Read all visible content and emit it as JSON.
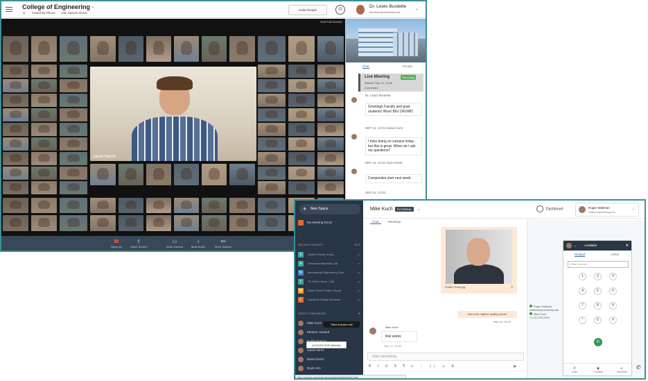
{
  "top": {
    "org_name": "College of Engineering",
    "sub_items": [
      "Joined By Phone",
      "Join Spaces Room"
    ],
    "invite_label": "Invite People",
    "user_name": "Dr. Lewis Burdette",
    "user_email": "lburdette@university.edu",
    "exit_fullscreen": "Exit Full Screen"
  },
  "meeting": {
    "active_speaker": "Jared Harris",
    "toolbar": [
      "Hang Up",
      "Share Screen",
      "Mute Camera",
      "Mute Audio",
      "More Options"
    ]
  },
  "chat_panel": {
    "tabs": [
      "Chat",
      "People"
    ],
    "live_title": "Live Meeting",
    "live_badge": "Recording",
    "live_started": "Started: Sep 14, 13:30",
    "live_sub": "Connected",
    "messages": [
      {
        "meta": "Dr. Lewis Burdette",
        "text": "Greetings Faculty and grad students! Wow! BIG CROWD"
      },
      {
        "meta": "SEP 14, 13:31  Diana Gorst",
        "text": "I miss being on campus today - but this is great. When do I ask my questions?"
      },
      {
        "meta": "SEP 14, 13:32  Arjun Khatri",
        "text": "Composites start next week."
      },
      {
        "meta": "SEP 14, 13:33",
        "text": ""
      }
    ]
  },
  "messaging": {
    "new_space": "New Space",
    "my_meeting_room": "My Meeting Room",
    "section_spaces": "RECENT SPACES",
    "spaces": [
      {
        "letter": "S",
        "color": "#3aa8a0",
        "label": "Student Study Group"
      },
      {
        "letter": "A",
        "color": "#3aa8a0",
        "label": "Advanced Materials Lab"
      },
      {
        "letter": "M",
        "color": "#4a82c0",
        "label": "Mechanical Engineering Dept"
      },
      {
        "letter": "T",
        "color": "#3aa8a0",
        "label": "TA Office Hours - Fall"
      },
      {
        "letter": "W",
        "color": "#e8a030",
        "label": "Wind Tunnel Project Group"
      },
      {
        "letter": "C",
        "color": "#e06a3a",
        "label": "Capstone Design Reviews"
      }
    ],
    "section_direct": "DIRECT MESSAGES",
    "direct": [
      "Mike Kuch",
      "Eleanor Howard",
      "Ruthie Ramos",
      "Jared Harris",
      "Diana Gorst",
      "Noah Kim"
    ],
    "tooltip1": "Start a phone call",
    "tooltip2": "(412)225-0199 (Mobile)",
    "status_url": "https://spaces.university.edu/messaging/direct/mike-kuch"
  },
  "conversation": {
    "name": "Mike Kuch",
    "badge": "EXTERNAL",
    "dashboard": "Dashboard",
    "presence_name": "Roger Wallman",
    "presence_email": "rwallman@university.edu",
    "tabs": [
      "Chat",
      "Meetings"
    ],
    "photo_file": "Profile Photo.jpg",
    "photo_caption": "this is the highest quality picture",
    "ts1": "Sep 14, 13:42",
    "sender": "Mike Kuch",
    "message": "that works",
    "ts2": "Sep 14, 13:44",
    "compose_placeholder": "Start something",
    "format_tools": "B I U S ¶ ≡ ⋮ ⟨⟩ ☺ A",
    "call_log": [
      "Roger Wallman",
      "rwallman@university.edu",
      "Mike Kuch",
      "+1 412 225 0199"
    ]
  },
  "dialer": {
    "status": "Available",
    "tabs": [
      "Dialpad",
      "Active"
    ],
    "input_placeholder": "Enter number",
    "keys": [
      "1",
      "2",
      "3",
      "4",
      "5",
      "6",
      "7",
      "8",
      "9",
      "*",
      "0",
      "#"
    ],
    "bottom": [
      "Calls",
      "Contacts",
      "Voicemail"
    ]
  },
  "colors": {
    "accent": "#3c8f95",
    "toolbar": "#394856",
    "sidebar": "#293645"
  }
}
